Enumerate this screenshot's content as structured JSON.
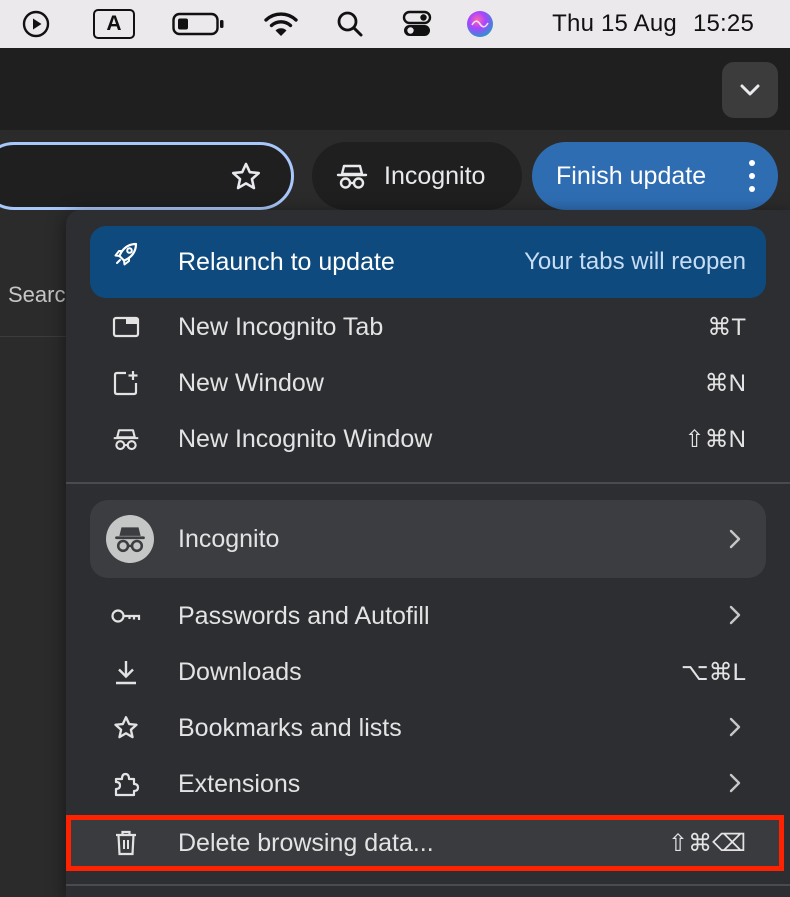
{
  "menubar": {
    "icons": [
      "play-circle-icon",
      "keyboard-input-a-icon",
      "battery-icon",
      "wifi-icon",
      "search-icon",
      "control-center-icon",
      "siri-icon"
    ],
    "input_letter": "A",
    "date": "Thu 15 Aug",
    "time": "15:25"
  },
  "toolbar": {
    "incognito_label": "Incognito",
    "update_label": "Finish update",
    "search_fragment": "Searc"
  },
  "menu": {
    "relaunch": {
      "label": "Relaunch to update",
      "hint": "Your tabs will reopen"
    },
    "items_top": [
      {
        "icon": "tab-icon",
        "label": "New Incognito Tab",
        "shortcut": "⌘T"
      },
      {
        "icon": "new-window-icon",
        "label": "New Window",
        "shortcut": "⌘N"
      },
      {
        "icon": "incognito-icon",
        "label": "New Incognito Window",
        "shortcut": "⇧⌘N"
      }
    ],
    "profile": {
      "label": "Incognito"
    },
    "items_bottom": [
      {
        "icon": "key-icon",
        "label": "Passwords and Autofill",
        "submenu": true
      },
      {
        "icon": "download-icon",
        "label": "Downloads",
        "shortcut": "⌥⌘L"
      },
      {
        "icon": "star-icon",
        "label": "Bookmarks and lists",
        "submenu": true
      },
      {
        "icon": "puzzle-icon",
        "label": "Extensions",
        "submenu": true
      },
      {
        "icon": "trash-icon",
        "label": "Delete browsing data...",
        "shortcut": "⇧⌘⌫"
      }
    ]
  },
  "colors": {
    "accent": "#2f6db3",
    "relaunch_bg": "#0e4a7d",
    "highlight_border": "#ff2200",
    "menu_bg": "#2d2e31"
  }
}
